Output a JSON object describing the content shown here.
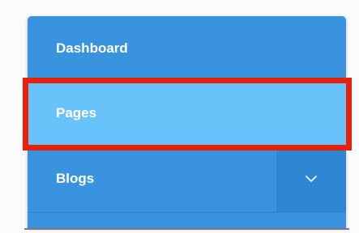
{
  "sidebar": {
    "items": [
      {
        "label": "Dashboard"
      },
      {
        "label": "Pages"
      },
      {
        "label": "Blogs"
      }
    ],
    "expand_icon": "chevron-down-icon"
  },
  "colors": {
    "sidebar_bg": "#3a93df",
    "active_bg": "#69c3fb",
    "chevron_bg": "#2e87d3",
    "highlight_border": "#e8210f",
    "text": "#ffffff"
  }
}
